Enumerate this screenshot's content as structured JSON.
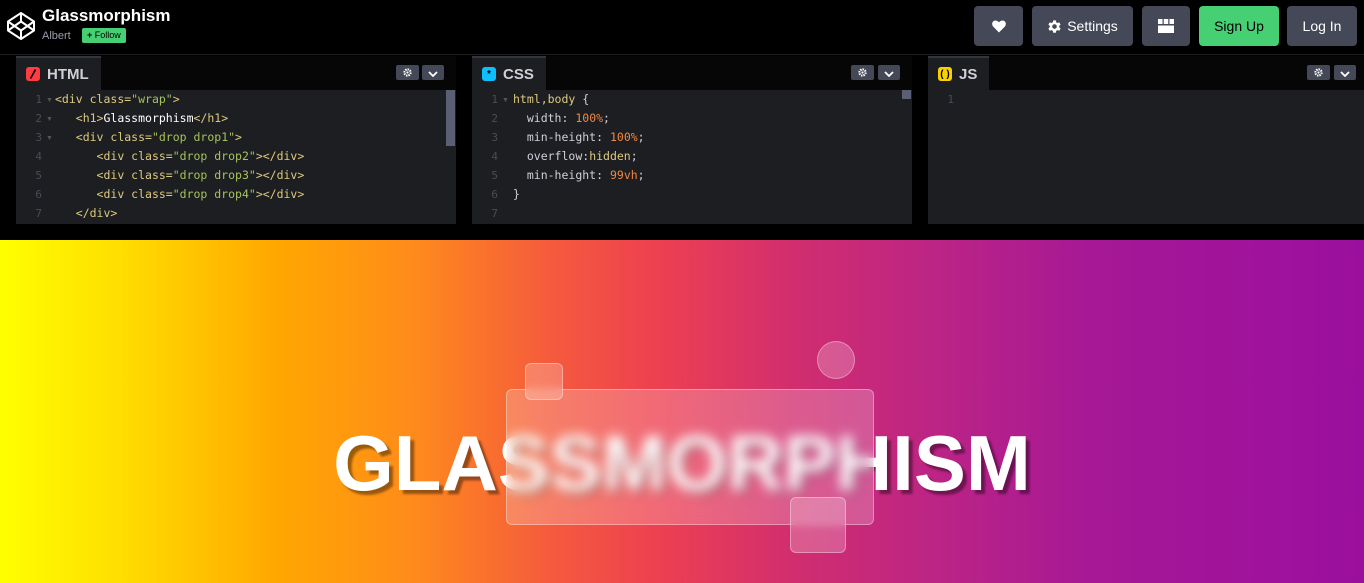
{
  "header": {
    "title": "Glassmorphism",
    "author": "Albert",
    "follow_label": "Follow",
    "settings_label": "Settings",
    "signup_label": "Sign Up",
    "login_label": "Log In"
  },
  "editors": {
    "html": {
      "tab_label": "HTML",
      "icon_color": "#ff3c41",
      "line_numbers": [
        "1",
        "2",
        "3",
        "4",
        "5",
        "6",
        "7"
      ]
    },
    "css": {
      "tab_label": "CSS",
      "icon_color": "#0ebeff",
      "line_numbers": [
        "1",
        "2",
        "3",
        "4",
        "5",
        "6",
        "7"
      ]
    },
    "js": {
      "tab_label": "JS",
      "icon_color": "#fcd000",
      "line_numbers": [
        "1"
      ]
    }
  },
  "preview": {
    "heading": "GLASSMORPHISM"
  },
  "colors": {
    "accent_green": "#47cf73",
    "button_gray": "#444857"
  }
}
